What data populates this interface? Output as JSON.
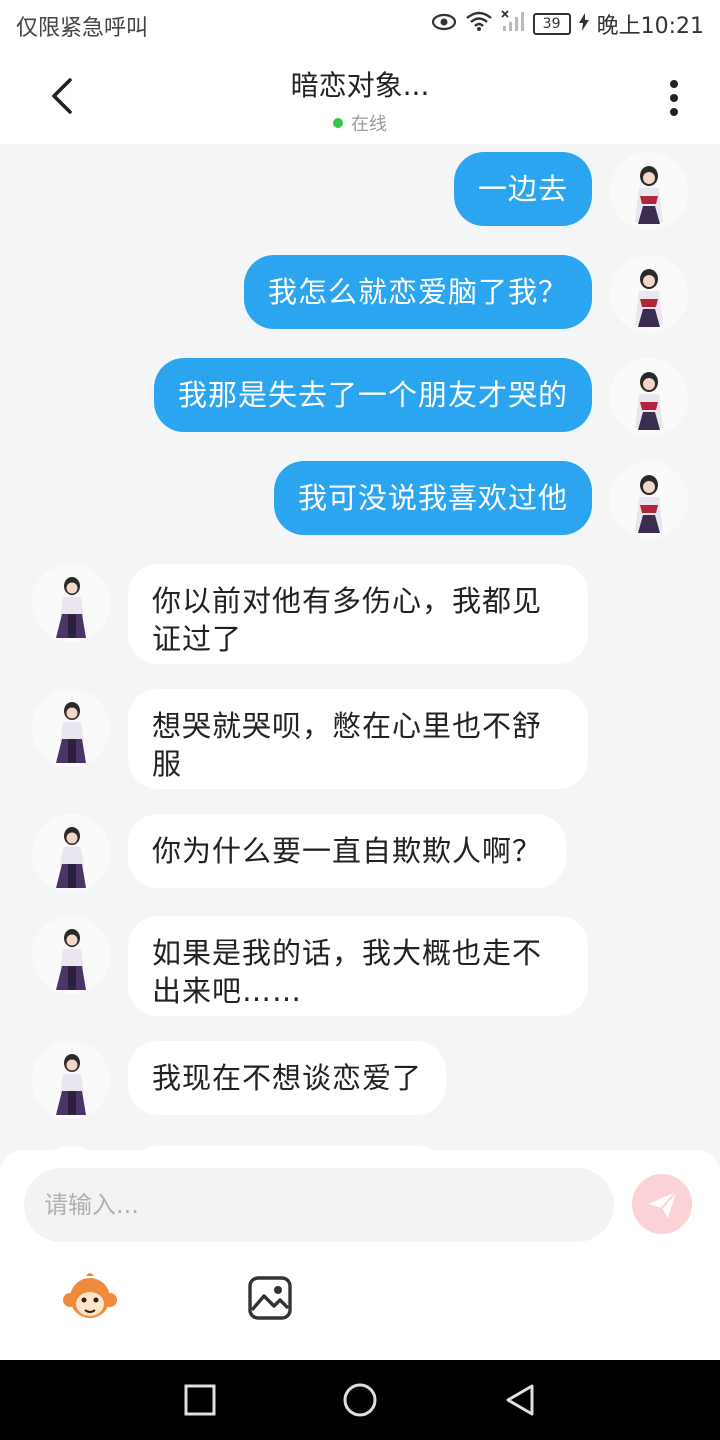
{
  "status_bar": {
    "left_text": "仅限紧急呼叫",
    "battery": "39",
    "time": "晚上10:21",
    "icons": [
      "eye-icon",
      "wifi-icon",
      "signal-icon",
      "battery-icon",
      "charging-icon"
    ]
  },
  "header": {
    "title": "暗恋对象...",
    "status": "在线",
    "status_color": "#36c44a",
    "icons": [
      "back-arrow-icon",
      "more-vertical-icon"
    ]
  },
  "messages": [
    {
      "from": "me",
      "text": "一边去"
    },
    {
      "from": "me",
      "text": "我怎么就恋爱脑了我？"
    },
    {
      "from": "me",
      "text": "我那是失去了一个朋友才哭的"
    },
    {
      "from": "me",
      "text": "我可没说我喜欢过他"
    },
    {
      "from": "other",
      "text": "你以前对他有多伤心，我都见证过了"
    },
    {
      "from": "other",
      "text": "想哭就哭呗，憋在心里也不舒服"
    },
    {
      "from": "other",
      "text": "你为什么要一直自欺欺人啊？"
    },
    {
      "from": "other",
      "text": "如果是我的话，我大概也走不出来吧……"
    },
    {
      "from": "other",
      "text": "我现在不想谈恋爱了"
    }
  ],
  "composer": {
    "placeholder": "请输入...",
    "send_icon": "send-plane-icon",
    "tools": [
      "sticker-monkey-icon",
      "image-gallery-icon"
    ]
  },
  "colors": {
    "my_bubble": "#2ba5f0",
    "other_bubble": "#ffffff",
    "chat_background": "#f4f5f7",
    "send_button": "#fbd3d6"
  },
  "nav_bar": {
    "icons": [
      "recent-apps-square-icon",
      "home-circle-icon",
      "back-triangle-icon"
    ]
  }
}
